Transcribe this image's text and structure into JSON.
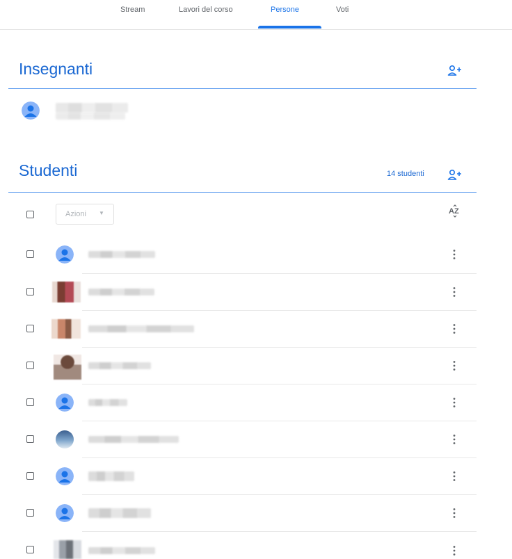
{
  "tabs": [
    {
      "label": "Stream",
      "active": false
    },
    {
      "label": "Lavori del corso",
      "active": false
    },
    {
      "label": "Persone",
      "active": true
    },
    {
      "label": "Voti",
      "active": false
    }
  ],
  "teachers": {
    "title": "Insegnanti",
    "add_icon": "person-add-icon"
  },
  "students": {
    "title": "Studenti",
    "count_label": "14 studenti",
    "add_icon": "person-add-icon",
    "actions_label": "Azioni",
    "sort_icon": "sort-az-icon"
  },
  "colors": {
    "accent": "#1a73e8",
    "title": "#1967d2",
    "avatar_default": "#8ab4f8"
  }
}
